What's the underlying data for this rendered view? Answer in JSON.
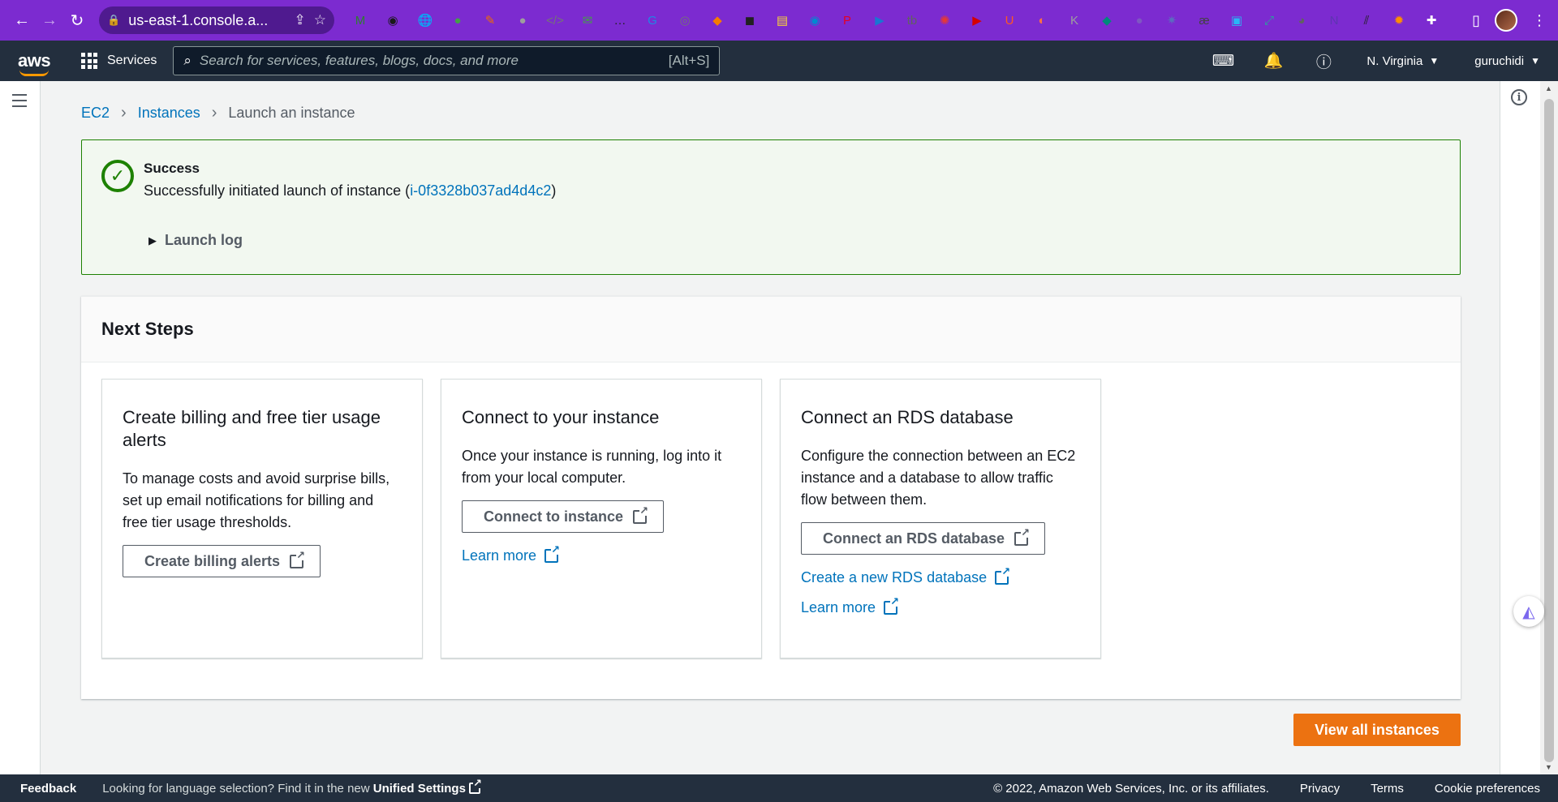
{
  "browser": {
    "url": "us-east-1.console.a...",
    "extensions": [
      {
        "name": "m-icon",
        "glyph": "M",
        "color": "#2e7d32"
      },
      {
        "name": "new-badge-icon",
        "glyph": "◉",
        "color": "#1a1a1a"
      },
      {
        "name": "globe-icon",
        "glyph": "🌐",
        "color": "#1565c0"
      },
      {
        "name": "dots-icon",
        "glyph": "●",
        "color": "#43a047"
      },
      {
        "name": "brush-icon",
        "glyph": "✎",
        "color": "#ef6c00"
      },
      {
        "name": "circle-icon",
        "glyph": "●",
        "color": "#9e9e9e"
      },
      {
        "name": "code-icon",
        "glyph": "</>",
        "color": "#757575"
      },
      {
        "name": "mail-icon",
        "glyph": "✉",
        "color": "#43a047"
      },
      {
        "name": "more-icon",
        "glyph": "…",
        "color": "#212121"
      },
      {
        "name": "translate-icon",
        "glyph": "G",
        "color": "#1e88e5"
      },
      {
        "name": "camera-icon",
        "glyph": "◎",
        "color": "#757575"
      },
      {
        "name": "fox-icon",
        "glyph": "◆",
        "color": "#f57c00"
      },
      {
        "name": "mask-icon",
        "glyph": "◼",
        "color": "#212121"
      },
      {
        "name": "note-icon",
        "glyph": "▤",
        "color": "#fdd835"
      },
      {
        "name": "eye-icon",
        "glyph": "◉",
        "color": "#0288d1"
      },
      {
        "name": "pinterest-icon",
        "glyph": "P",
        "color": "#e60023"
      },
      {
        "name": "play-icon",
        "glyph": "▶",
        "color": "#1976d2"
      },
      {
        "name": "tb-icon",
        "glyph": "tb",
        "color": "#616161"
      },
      {
        "name": "color-icon",
        "glyph": "✺",
        "color": "#e53935"
      },
      {
        "name": "video-icon",
        "glyph": "▶",
        "color": "#d50000"
      },
      {
        "name": "u-icon",
        "glyph": "U",
        "color": "#ff5722"
      },
      {
        "name": "firefox-icon",
        "glyph": "◐",
        "color": "#ff7043"
      },
      {
        "name": "k-icon",
        "glyph": "K",
        "color": "#9e9e9e"
      },
      {
        "name": "diamond-icon",
        "glyph": "◆",
        "color": "#00897b"
      },
      {
        "name": "chat-icon",
        "glyph": "●",
        "color": "#7e57c2"
      },
      {
        "name": "spark-icon",
        "glyph": "✷",
        "color": "#5c6bc0"
      },
      {
        "name": "ae-icon",
        "glyph": "æ",
        "color": "#424242"
      },
      {
        "name": "image-icon",
        "glyph": "▣",
        "color": "#29b6f6"
      },
      {
        "name": "expand-icon",
        "glyph": "⤢",
        "color": "#26a69a"
      },
      {
        "name": "x-badge-icon",
        "glyph": "◕",
        "color": "#616161"
      },
      {
        "name": "n-icon",
        "glyph": "N",
        "color": "#5e35b1"
      },
      {
        "name": "dash-icon",
        "glyph": "⫽",
        "color": "#212121"
      },
      {
        "name": "film-icon",
        "glyph": "✹",
        "color": "#ff8f00"
      },
      {
        "name": "puzzle-icon",
        "glyph": "✚",
        "color": "#ffffff"
      }
    ]
  },
  "aws_nav": {
    "logo": "aws",
    "services_label": "Services",
    "search_placeholder": "Search for services, features, blogs, docs, and more",
    "search_shortcut": "[Alt+S]",
    "region": "N. Virginia",
    "user": "guruchidi"
  },
  "breadcrumb": {
    "items": [
      "EC2",
      "Instances"
    ],
    "current": "Launch an instance"
  },
  "flash": {
    "title": "Success",
    "message_prefix": "Successfully initiated launch of instance (",
    "instance_id": "i-0f3328b037ad4d4c2",
    "message_suffix": ")",
    "launch_log": "Launch log"
  },
  "next_steps": {
    "title": "Next Steps",
    "cards": [
      {
        "title": "Create billing and free tier usage alerts",
        "description": "To manage costs and avoid surprise bills, set up email notifications for billing and free tier usage thresholds.",
        "button": "Create billing alerts"
      },
      {
        "title": "Connect to your instance",
        "description": "Once your instance is running, log into it from your local computer.",
        "button": "Connect to instance",
        "link1": "Learn more"
      },
      {
        "title": "Connect an RDS database",
        "description": "Configure the connection between an EC2 instance and a database to allow traffic flow between them.",
        "button": "Connect an RDS database",
        "link1": "Create a new RDS database",
        "link2": "Learn more"
      }
    ]
  },
  "primary_button": "View all instances",
  "footer": {
    "feedback": "Feedback",
    "lang_prefix": "Looking for language selection? Find it in the new",
    "lang_link": "Unified Settings",
    "copyright": "© 2022, Amazon Web Services, Inc. or its affiliates.",
    "privacy": "Privacy",
    "terms": "Terms",
    "cookies": "Cookie preferences"
  },
  "colors": {
    "accent_orange": "#ec7211",
    "success_green": "#1d8102",
    "link_blue": "#0073bb",
    "nav_dark": "#232f3e",
    "chrome_purple": "#7c2bd0"
  }
}
